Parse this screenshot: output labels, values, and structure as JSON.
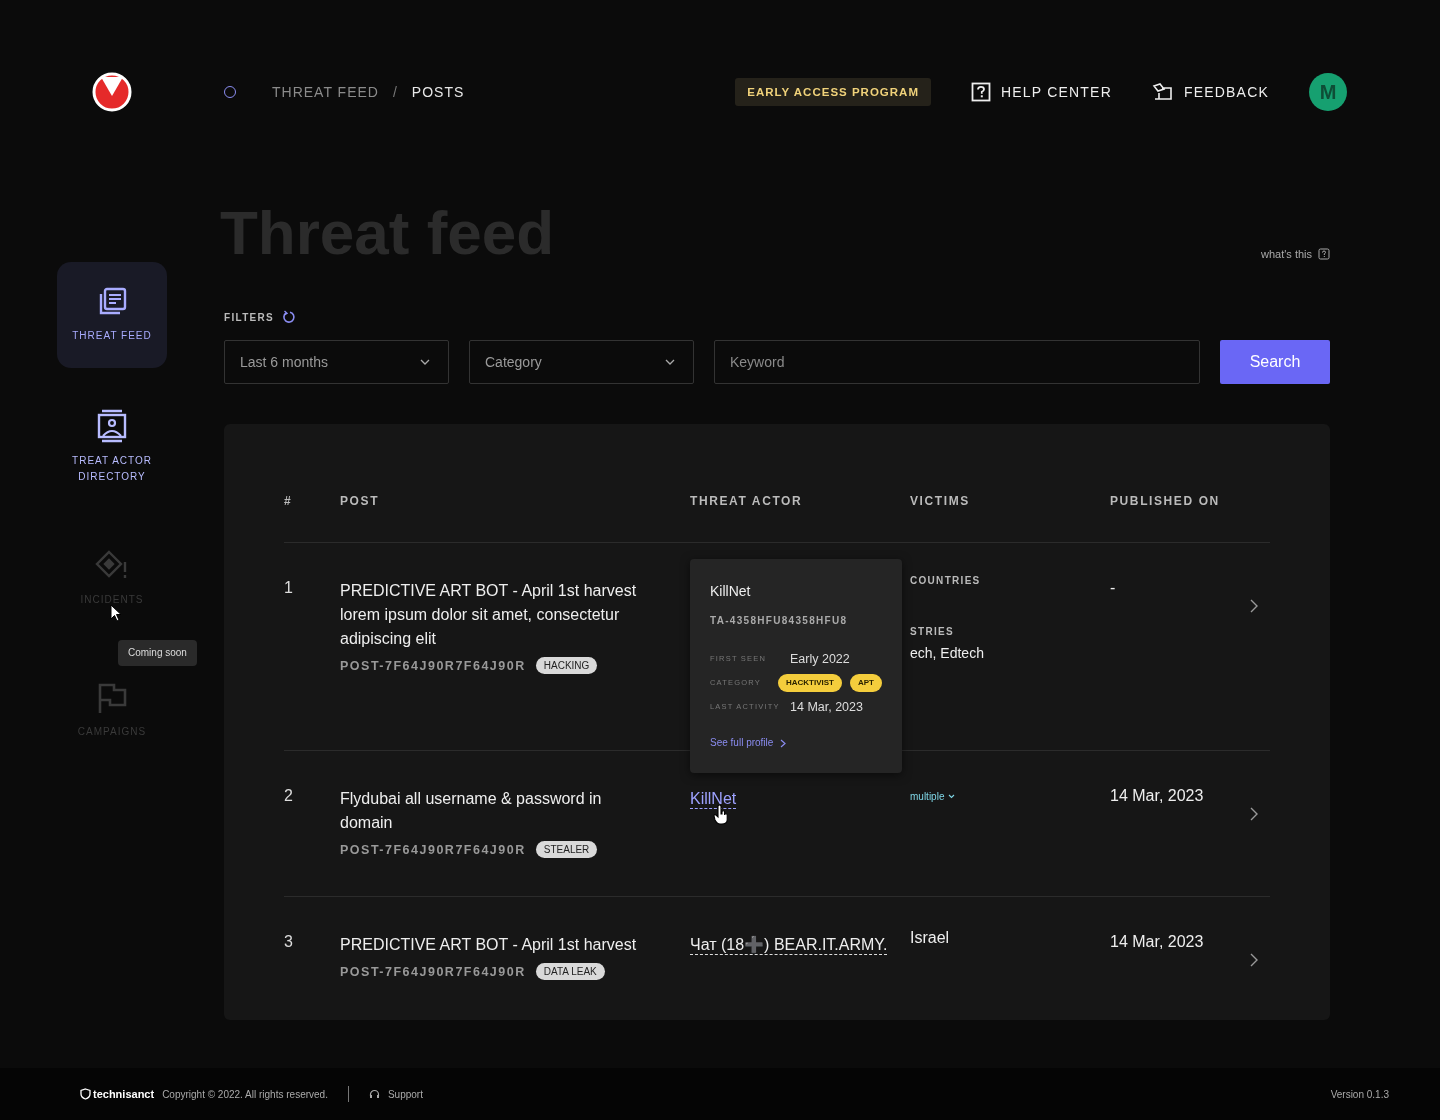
{
  "header": {
    "breadcrumb_separator": "/",
    "breadcrumb": [
      {
        "label": "THREAT FEED",
        "selected": false
      },
      {
        "label": "POSTS",
        "selected": true
      }
    ],
    "early_access": "EARLY ACCESS PROGRAM",
    "help": "HELP CENTER",
    "feedback": "FEEDBACK",
    "avatar": "M"
  },
  "sidebar": {
    "items": [
      {
        "label": "THREAT FEED",
        "selected": true,
        "disabled": false
      },
      {
        "label": "TREAT ACTOR DIRECTORY",
        "selected": false,
        "disabled": false
      },
      {
        "label": "INCIDENTS",
        "selected": false,
        "disabled": true,
        "tooltip": "Coming soon"
      },
      {
        "label": "CAMPAIGNS",
        "selected": false,
        "disabled": true
      }
    ]
  },
  "page": {
    "title": "Threat feed",
    "help_link": "what's this"
  },
  "filters": {
    "label": "FILTERS",
    "period": "Last 6 months",
    "category": {
      "placeholder": "Category"
    },
    "keyword": {
      "placeholder": "Keyword"
    },
    "search_button": "Search"
  },
  "table": {
    "columns": [
      "#",
      "POST",
      "THREAT ACTOR",
      "VICTIMS",
      "PUBLISHED ON"
    ],
    "rows": [
      {
        "number": "1",
        "post": "PREDICTIVE ART BOT - April 1st harvest lorem ipsum dolor sit amet, consectetur adipiscing elit",
        "post_id": "POST-7F64J90R7F64J90R",
        "tag": "HACKING",
        "victims": {
          "kind": "groups",
          "groups": [
            {
              "label": "COUNTRIES"
            },
            {
              "label": "STRIES",
              "value": "ech, Edtech"
            }
          ]
        },
        "published": "-"
      },
      {
        "number": "2",
        "post": "Flydubai all username & password in domain",
        "post_id": "POST-7F64J90R7F64J90R",
        "tag": "STEALER",
        "actor": {
          "kind": "link",
          "text": "KillNet"
        },
        "victims": {
          "kind": "dropdown",
          "text": "multiple"
        },
        "published": "14 Mar, 2023",
        "popover": {
          "name": "KillNet",
          "id": "TA-4358HFU84358HFU8",
          "fields": [
            {
              "kind": "text",
              "label": "FIRST SEEN",
              "value": "Early 2022"
            },
            {
              "kind": "tags",
              "label": "CATEGORY",
              "tags": [
                "HACKTIVIST",
                "APT"
              ]
            },
            {
              "kind": "text",
              "label": "LAST ACTIVITY",
              "value": "14 Mar, 2023"
            }
          ],
          "link": "See full profile"
        }
      },
      {
        "number": "3",
        "post": "PREDICTIVE ART BOT - April 1st harvest",
        "post_id": "POST-7F64J90R7F64J90R",
        "tag": "DATA LEAK",
        "actor": {
          "kind": "plain",
          "text": "Чат (18➕) BEAR.IT.ARMY."
        },
        "victims": {
          "kind": "text",
          "text": "Israel"
        },
        "published": "14 Mar, 2023"
      }
    ]
  },
  "footer": {
    "brand": "technisanct",
    "copyright": "Copyright © 2022. All rights reserved.",
    "support": "Support",
    "version": "Version 0.1.3"
  }
}
